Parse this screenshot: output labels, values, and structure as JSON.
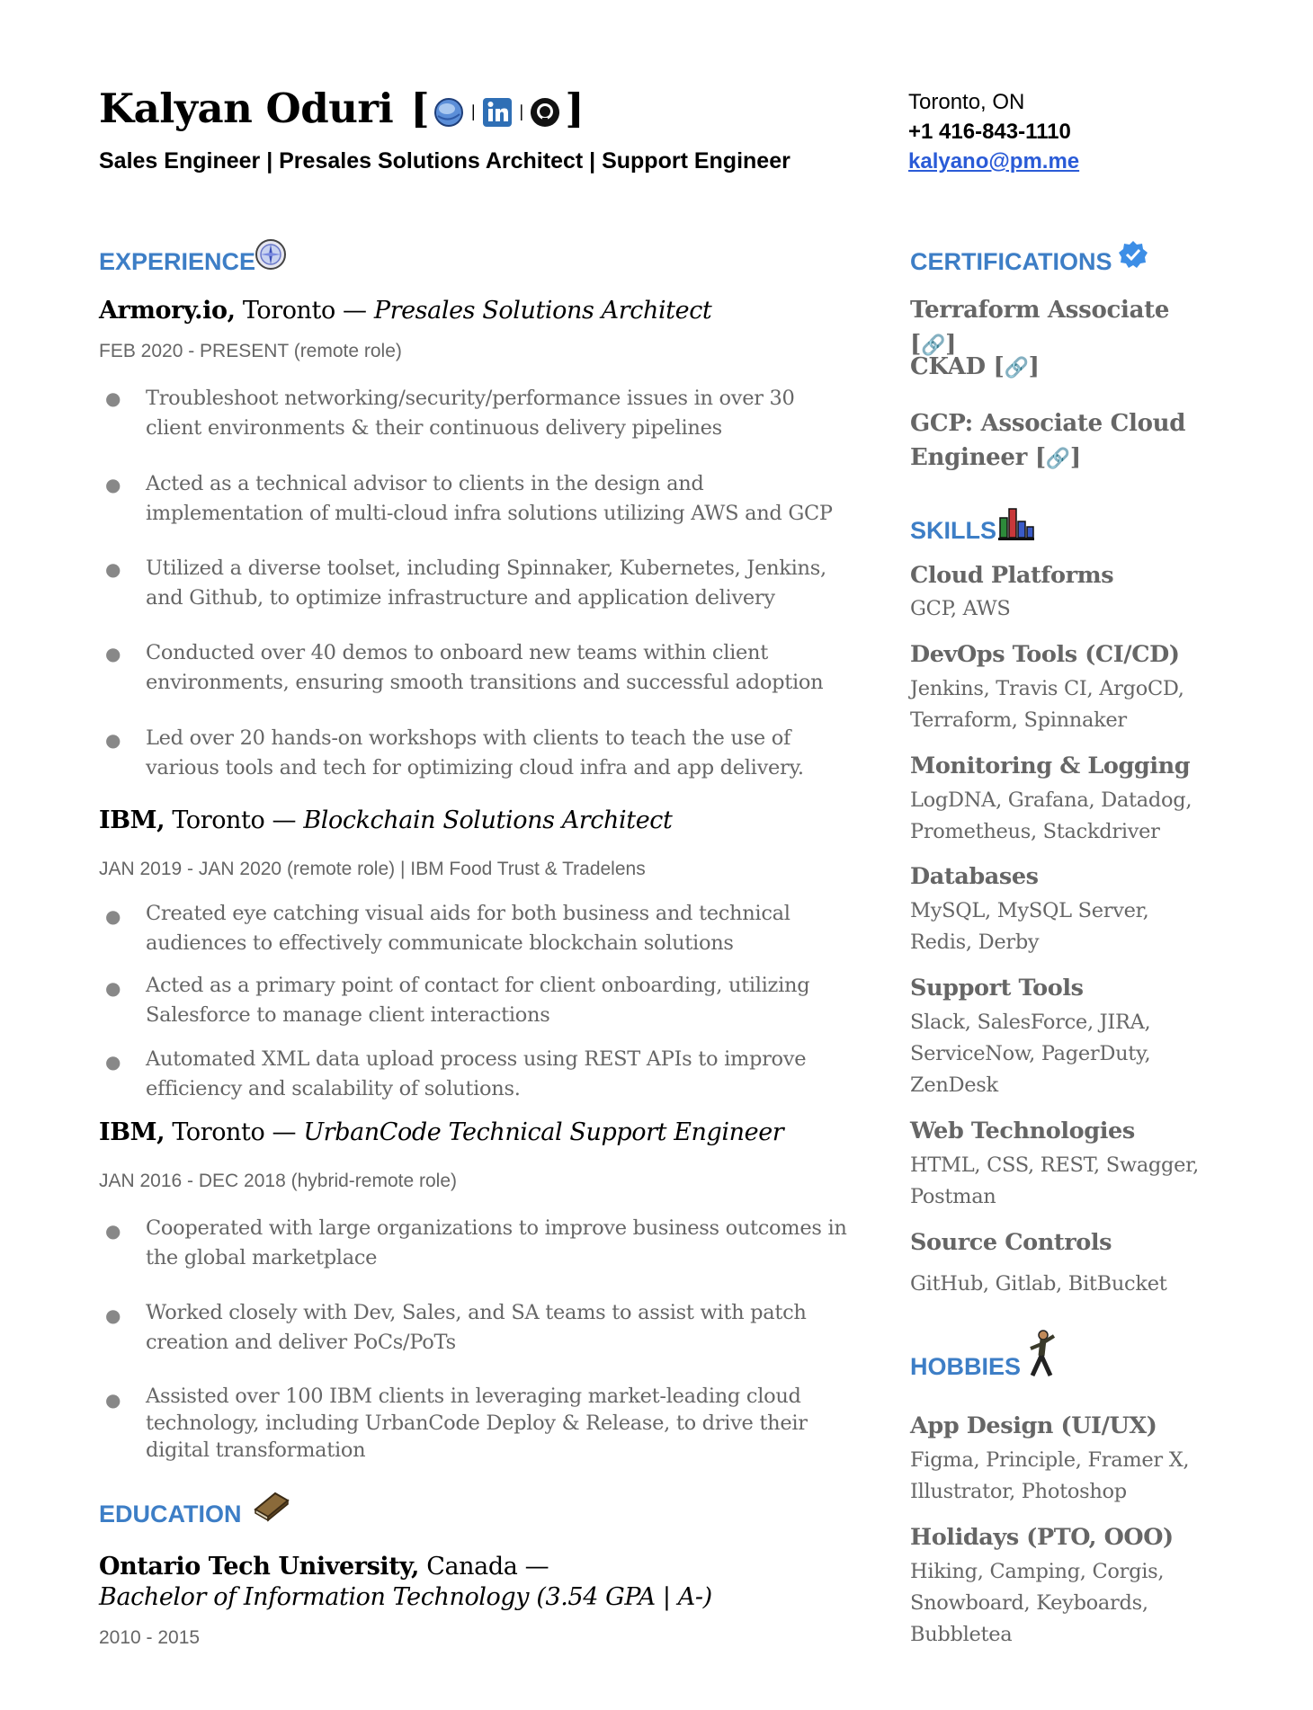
{
  "header": {
    "name": "Kalyan Oduri",
    "bracket_open": "[",
    "bracket_close": "]",
    "separator": "|",
    "icons": [
      "globe-icon",
      "linkedin-icon",
      "github-icon"
    ],
    "subtitle": "Sales Engineer | Presales Solutions Architect | Support Engineer"
  },
  "contact": {
    "location": "Toronto, ON",
    "phone": "+1 416-843-1110",
    "email": "kalyano@pm.me"
  },
  "experience": {
    "heading": "EXPERIENCE",
    "icon": "compass-icon",
    "jobs": [
      {
        "company": "Armory.io,",
        "rest": " Toronto — ",
        "role": "Presales Solutions Architect",
        "dates": "FEB 2020 - PRESENT (remote role)",
        "bullets": [
          "Troubleshoot networking/security/performance issues in over 30 client environments & their continuous delivery pipelines",
          "Acted as a technical advisor to clients in the design and implementation of multi-cloud infra  solutions utilizing AWS and GCP",
          "Utilized a diverse toolset, including Spinnaker, Kubernetes, Jenkins, and Github, to optimize infrastructure and application delivery",
          "Conducted over 40 demos to onboard new teams within client environments, ensuring smooth transitions and successful adoption",
          "Led over 20 hands-on workshops with clients to teach the use of various tools and tech for optimizing cloud infra and app delivery."
        ]
      },
      {
        "company": "IBM,",
        "rest": " Toronto — ",
        "role": "Blockchain Solutions Architect",
        "dates": "JAN 2019 - JAN 2020 (remote role) | IBM Food Trust & Tradelens",
        "bullets": [
          "Created eye catching visual aids for both business and technical audiences to effectively communicate blockchain solutions",
          "Acted as a primary point of contact for client onboarding, utilizing Salesforce to manage client interactions",
          "Automated XML data upload process using REST APIs to improve efficiency and scalability of solutions."
        ]
      },
      {
        "company": "IBM,",
        "rest": " Toronto — ",
        "role": "UrbanCode Technical Support Engineer",
        "dates": "JAN 2016 - DEC 2018 (hybrid-remote role)",
        "bullets": [
          "Cooperated with large organizations to improve business outcomes in the global marketplace",
          "Worked closely with Dev, Sales, and SA teams to assist with patch creation and deliver PoCs/PoTs",
          "Assisted over 100 IBM clients in leveraging market-leading cloud technology, including UrbanCode Deploy & Release, to drive their digital transformation"
        ]
      }
    ]
  },
  "education": {
    "heading": "EDUCATION",
    "icon": "book-icon",
    "school": "Ontario Tech University,",
    "location": " Canada —",
    "degree": "Bachelor of Information Technology (3.54 GPA | A-)",
    "dates": "2010 - 2015"
  },
  "certifications": {
    "heading": "CERTIFICATIONS",
    "icon": "verified-badge-icon",
    "link_glyph": "🔗",
    "items": [
      {
        "pre": "Terraform Associate [",
        "post": "]"
      },
      {
        "pre": "CKAD [",
        "post": "]"
      },
      {
        "pre": "GCP: Associate Cloud Engineer [",
        "post": "]"
      }
    ]
  },
  "skills": {
    "heading": "SKILLS",
    "icon": "bar-chart-icon",
    "groups": [
      {
        "title": "Cloud Platforms",
        "value": "GCP, AWS"
      },
      {
        "title": "DevOps Tools (CI/CD)",
        "value": "Jenkins, Travis CI, ArgoCD, Terraform, Spinnaker"
      },
      {
        "title": "Monitoring & Logging",
        "value": "LogDNA, Grafana, Datadog, Prometheus, Stackdriver"
      },
      {
        "title": "Databases",
        "value": "MySQL, MySQL Server, Redis, Derby"
      },
      {
        "title": "Support Tools",
        "value": "Slack, SalesForce, JIRA, ServiceNow, PagerDuty, ZenDesk"
      },
      {
        "title": "Web Technologies",
        "value": "HTML, CSS, REST, Swagger, Postman"
      },
      {
        "title": "Source Controls",
        "value": "GitHub, Gitlab, BitBucket"
      }
    ]
  },
  "hobbies": {
    "heading": "HOBBIES",
    "icon": "dancing-person-icon",
    "groups": [
      {
        "title": "App Design (UI/UX)",
        "value": "Figma, Principle, Framer X, Illustrator, Photoshop"
      },
      {
        "title": "Holidays (PTO, OOO)",
        "value": "Hiking, Camping, Corgis, Snowboard, Keyboards, Bubbletea"
      }
    ]
  }
}
